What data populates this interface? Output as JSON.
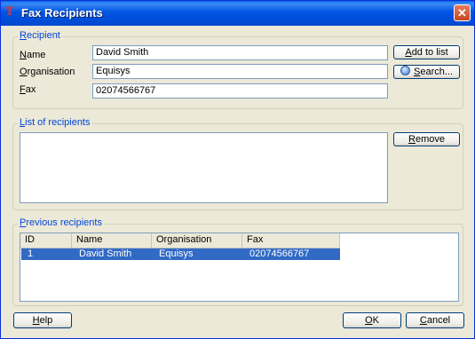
{
  "window": {
    "title": "Fax Recipients",
    "close_glyph": "✕",
    "app_icon": "fax-app-icon"
  },
  "recipient": {
    "group_label": "Recipient",
    "name_label": "Name",
    "organisation_label": "Organisation",
    "fax_label": "Fax",
    "name_value": "David Smith",
    "organisation_value": "Equisys",
    "fax_value": "02074566767",
    "add_button": "Add to list",
    "search_button": "Search..."
  },
  "recipients_list": {
    "group_label": "List of recipients",
    "remove_button": "Remove",
    "items": []
  },
  "previous": {
    "group_label": "Previous recipients",
    "columns": [
      "ID",
      "Name",
      "Organisation",
      "Fax"
    ],
    "rows": [
      {
        "id": "1",
        "name": "David Smith",
        "organisation": "Equisys",
        "fax": "02074566767",
        "selected": true
      }
    ]
  },
  "footer": {
    "help_button": "Help",
    "ok_button": "OK",
    "cancel_button": "Cancel"
  },
  "colors": {
    "group_label": "#0046d5",
    "selection": "#316ac5",
    "titlebar": "#0054e3",
    "dialog_bg": "#ece9d8"
  }
}
